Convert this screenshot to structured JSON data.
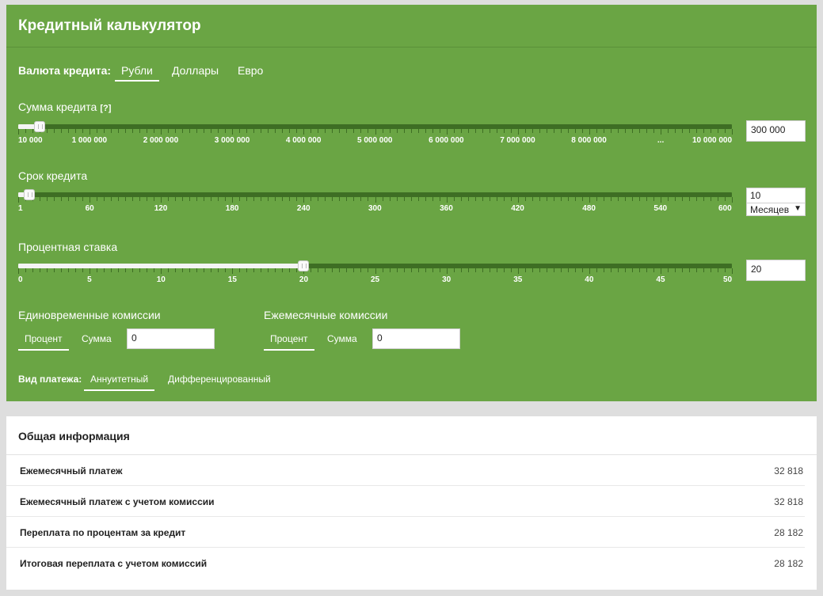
{
  "calculator": {
    "title": "Кредитный калькулятор",
    "currency": {
      "label": "Валюта кредита:",
      "options": [
        "Рубли",
        "Доллары",
        "Евро"
      ],
      "selected": "Рубли"
    },
    "amount": {
      "label": "Сумма кредита",
      "help": "[?]",
      "value": "300 000",
      "scale": [
        "10 000",
        "1 000 000",
        "2 000 000",
        "3 000 000",
        "4 000 000",
        "5 000 000",
        "6 000 000",
        "7 000 000",
        "8 000 000",
        "...",
        "10 000 000"
      ],
      "slider_fraction": 0.03
    },
    "term": {
      "label": "Срок кредита",
      "value": "10",
      "unit": "Месяцев",
      "scale": [
        "1",
        "60",
        "120",
        "180",
        "240",
        "300",
        "360",
        "420",
        "480",
        "540",
        "600"
      ],
      "slider_fraction": 0.015
    },
    "rate": {
      "label": "Процентная ставка",
      "value": "20",
      "scale": [
        "0",
        "5",
        "10",
        "15",
        "20",
        "25",
        "30",
        "35",
        "40",
        "45",
        "50"
      ],
      "slider_fraction": 0.4
    },
    "one_time_fees": {
      "label": "Единовременные комиссии",
      "tab_percent": "Процент",
      "tab_sum": "Сумма",
      "value": "0"
    },
    "monthly_fees": {
      "label": "Ежемесячные комиссии",
      "tab_percent": "Процент",
      "tab_sum": "Сумма",
      "value": "0"
    },
    "payment_type": {
      "label": "Вид платежа:",
      "options": [
        "Аннуитетный",
        "Дифференцированный"
      ],
      "selected": "Аннуитетный"
    }
  },
  "summary": {
    "title": "Общая информация",
    "rows": [
      {
        "label": "Ежемесячный платеж",
        "value": "32 818"
      },
      {
        "label": "Ежемесячный платеж с учетом комиссии",
        "value": "32 818"
      },
      {
        "label": "Переплата по процентам за кредит",
        "value": "28 182"
      },
      {
        "label": "Итоговая переплата с учетом комиссий",
        "value": "28 182"
      }
    ]
  },
  "colors": {
    "panel_green": "#6aa544",
    "track_dark": "#3e6e24"
  }
}
